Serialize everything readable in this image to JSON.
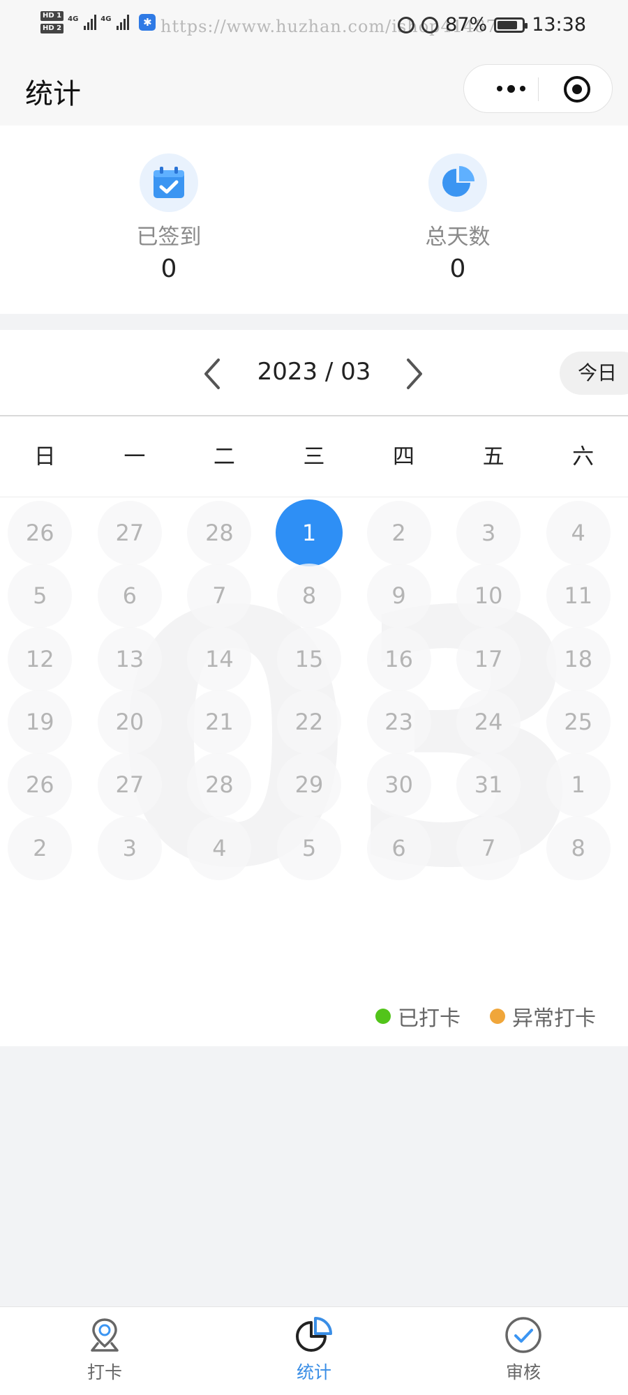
{
  "status_bar": {
    "hd1": "HD 1",
    "hd2": "HD 2",
    "net1": "4G",
    "net2": "4G",
    "watermark": "https://www.huzhan.com/ishop41487",
    "battery": "87%",
    "time": "13:38"
  },
  "nav": {
    "title": "统计",
    "more_icon": "more-dots-icon",
    "close_icon": "target-icon"
  },
  "stats": [
    {
      "icon": "calendar-check-icon",
      "label": "已签到",
      "value": "0"
    },
    {
      "icon": "pie-chart-icon",
      "label": "总天数",
      "value": "0"
    }
  ],
  "calendar": {
    "month_label": "2023 / 03",
    "month_watermark": "03",
    "today_button": "今日",
    "weekdays": [
      "日",
      "一",
      "二",
      "三",
      "四",
      "五",
      "六"
    ],
    "weeks": [
      [
        "26",
        "27",
        "28",
        "1",
        "2",
        "3",
        "4"
      ],
      [
        "5",
        "6",
        "7",
        "8",
        "9",
        "10",
        "11"
      ],
      [
        "12",
        "13",
        "14",
        "15",
        "16",
        "17",
        "18"
      ],
      [
        "19",
        "20",
        "21",
        "22",
        "23",
        "24",
        "25"
      ],
      [
        "26",
        "27",
        "28",
        "29",
        "30",
        "31",
        "1"
      ],
      [
        "2",
        "3",
        "4",
        "5",
        "6",
        "7",
        "8"
      ]
    ],
    "selected_day": "1",
    "legend": [
      {
        "label": "已打卡",
        "color": "#52c41a"
      },
      {
        "label": "异常打卡",
        "color": "#f0a63a"
      }
    ]
  },
  "tabs": [
    {
      "label": "打卡",
      "icon": "location-pin-icon",
      "active": false
    },
    {
      "label": "统计",
      "icon": "pie-chart-icon",
      "active": true
    },
    {
      "label": "审核",
      "icon": "check-circle-icon",
      "active": false
    }
  ],
  "colors": {
    "accent": "#2e8ff5",
    "active_tab": "#3a8ee6"
  }
}
